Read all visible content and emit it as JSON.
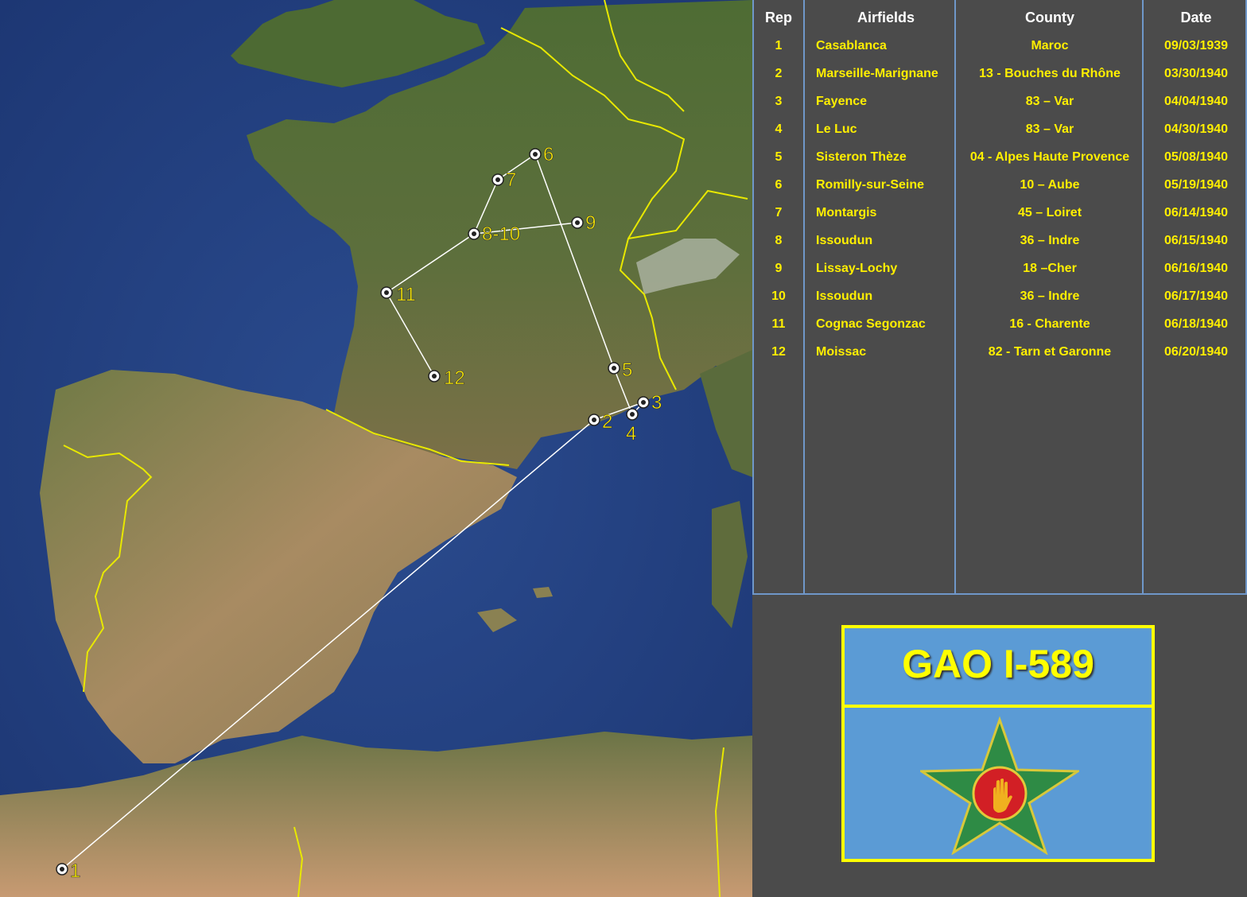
{
  "table": {
    "headers": {
      "rep": "Rep",
      "airfields": "Airfields",
      "county": "County",
      "date": "Date"
    },
    "rows": [
      {
        "rep": "1",
        "airfield": "Casablanca",
        "county": "Maroc",
        "date": "09/03/1939"
      },
      {
        "rep": "2",
        "airfield": "Marseille-Marignane",
        "county": "13 - Bouches du  Rhône",
        "date": "03/30/1940"
      },
      {
        "rep": "3",
        "airfield": "Fayence",
        "county": "83 – Var",
        "date": "04/04/1940"
      },
      {
        "rep": "4",
        "airfield": "Le Luc",
        "county": "83 – Var",
        "date": "04/30/1940"
      },
      {
        "rep": "5",
        "airfield": "Sisteron Thèze",
        "county": "04 - Alpes Haute Provence",
        "date": "05/08/1940"
      },
      {
        "rep": "6",
        "airfield": "Romilly-sur-Seine",
        "county": "10 – Aube",
        "date": "05/19/1940"
      },
      {
        "rep": "7",
        "airfield": "Montargis",
        "county": "45 – Loiret",
        "date": "06/14/1940"
      },
      {
        "rep": "8",
        "airfield": "Issoudun",
        "county": "36 – Indre",
        "date": "06/15/1940"
      },
      {
        "rep": "9",
        "airfield": "Lissay-Lochy",
        "county": "18 –Cher",
        "date": "06/16/1940"
      },
      {
        "rep": "10",
        "airfield": "Issoudun",
        "county": "36 – Indre",
        "date": "06/17/1940"
      },
      {
        "rep": "11",
        "airfield": "Cognac Segonzac",
        "county": "16 - Charente",
        "date": "06/18/1940"
      },
      {
        "rep": "12",
        "airfield": "Moissac",
        "county": "82 - Tarn et Garonne",
        "date": "06/20/1940"
      }
    ]
  },
  "emblem": {
    "title": "GAO I-589"
  },
  "map": {
    "route_order": [
      "1",
      "2",
      "3",
      "4",
      "5",
      "6",
      "7",
      "8-10",
      "9",
      "8-10",
      "11",
      "12"
    ],
    "markers": [
      {
        "id": "1",
        "label": "1"
      },
      {
        "id": "2",
        "label": "2"
      },
      {
        "id": "3",
        "label": "3"
      },
      {
        "id": "4",
        "label": "4"
      },
      {
        "id": "5",
        "label": "5"
      },
      {
        "id": "6",
        "label": "6"
      },
      {
        "id": "7",
        "label": "7"
      },
      {
        "id": "8-10",
        "label": "8-10"
      },
      {
        "id": "9",
        "label": "9"
      },
      {
        "id": "11",
        "label": "11"
      },
      {
        "id": "12",
        "label": "12"
      }
    ]
  },
  "colors": {
    "table_text": "#ffef00",
    "header_text": "#ffffff",
    "grid": "#6f97c9",
    "panel": "#4b4b4b",
    "emblem_bg": "#5b9bd5",
    "emblem_border": "#ffff00"
  }
}
